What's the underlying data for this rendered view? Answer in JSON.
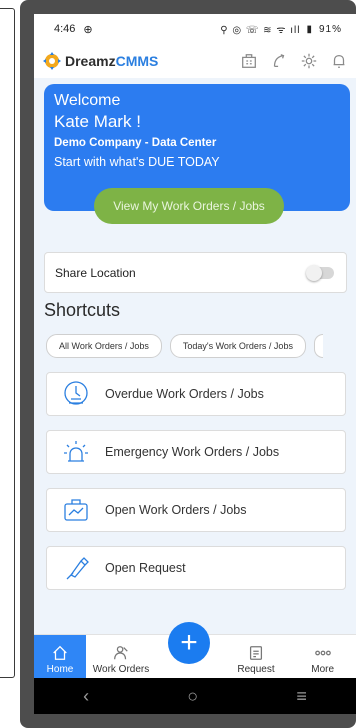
{
  "status_bar": {
    "time": "4:46",
    "battery": "91%"
  },
  "header": {
    "logo_part1": "Dreamz",
    "logo_part2": "CMMS"
  },
  "banner": {
    "welcome": "Welcome",
    "user_name": "Kate Mark !",
    "company": "Demo Company - Data Center",
    "prompt": "Start with what's DUE TODAY",
    "button_label": "View My Work Orders / Jobs"
  },
  "share_location": {
    "label": "Share Location",
    "enabled": false
  },
  "shortcuts": {
    "title": "Shortcuts",
    "chips": [
      "All Work Orders / Jobs",
      "Today's Work Orders / Jobs"
    ],
    "items": [
      {
        "label": "Overdue Work Orders / Jobs",
        "icon": "overdue-icon"
      },
      {
        "label": "Emergency Work Orders / Jobs",
        "icon": "emergency-icon"
      },
      {
        "label": "Open Work Orders / Jobs",
        "icon": "open-work-orders-icon"
      },
      {
        "label": "Open Request",
        "icon": "open-request-icon"
      }
    ]
  },
  "bottom_nav": {
    "items": [
      "Home",
      "Work Orders",
      "Request",
      "More"
    ],
    "add_label": "+"
  },
  "colors": {
    "primary": "#2c7cf0",
    "accent_green": "#7eb346",
    "device_frame": "#4d4d4d"
  }
}
